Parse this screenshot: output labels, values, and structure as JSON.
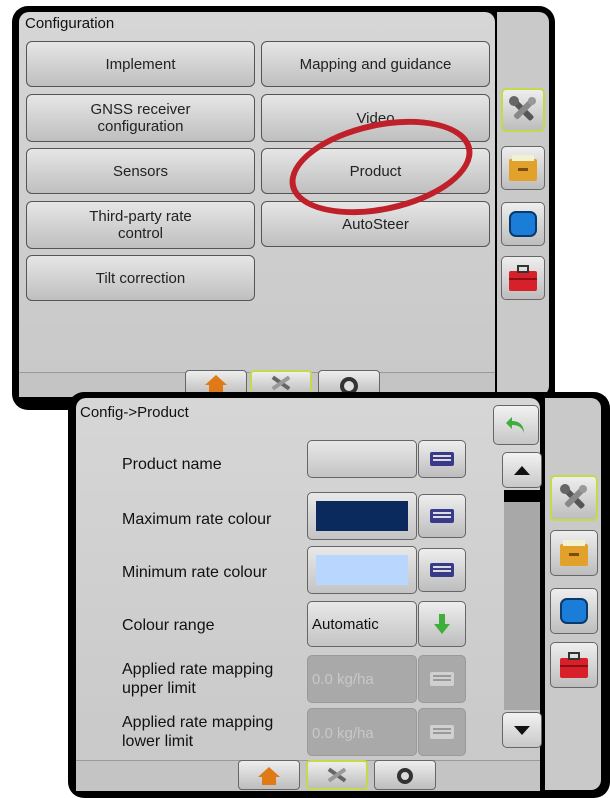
{
  "config_screen": {
    "title": "Configuration",
    "buttons": [
      {
        "label": "Implement"
      },
      {
        "label": "Mapping and guidance"
      },
      {
        "label": "GNSS receiver configuration"
      },
      {
        "label": "Video"
      },
      {
        "label": "Sensors"
      },
      {
        "label": "Product"
      },
      {
        "label": "Third-party rate control"
      },
      {
        "label": "AutoSteer"
      },
      {
        "label": "Tilt correction"
      }
    ],
    "side_tabs": [
      "tools-icon",
      "data-drawer-icon",
      "display-icon",
      "toolbox-icon"
    ],
    "bottom_tabs": [
      "home-icon",
      "tools-icon",
      "gauge-icon"
    ]
  },
  "product_screen": {
    "breadcrumb": "Config->Product",
    "rows": {
      "product_name": {
        "label": "Product name",
        "value": ""
      },
      "max_rate_colour": {
        "label": "Maximum rate colour",
        "color": "#0a2a5e"
      },
      "min_rate_colour": {
        "label": "Minimum rate colour",
        "color": "#b9d6ff"
      },
      "colour_range": {
        "label": "Colour range",
        "value": "Automatic"
      },
      "upper_limit": {
        "label": "Applied rate mapping upper limit",
        "value": "0.0 kg/ha"
      },
      "lower_limit": {
        "label": "Applied rate mapping lower limit",
        "value": "0.0 kg/ha"
      }
    },
    "side_tabs": [
      "tools-icon",
      "data-drawer-icon",
      "display-icon",
      "toolbox-icon"
    ],
    "bottom_tabs": [
      "home-icon",
      "tools-icon",
      "gauge-icon"
    ]
  },
  "colors": {
    "accent_green": "#c7d84a",
    "annotation_red": "#c0202a",
    "arrow_green": "#3fae3a"
  }
}
